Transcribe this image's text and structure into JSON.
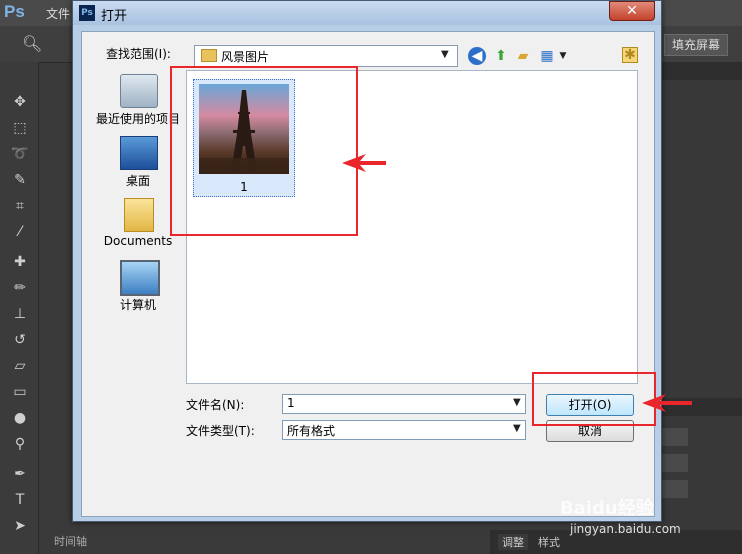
{
  "ps": {
    "logo": "Ps",
    "menu_file": "文件",
    "fill_screen": "填充屏幕",
    "timeline_tab": "时间轴",
    "adjust_tab": "调整",
    "style_tab": "样式"
  },
  "dialog": {
    "title": "打开",
    "close_symbol": "✕",
    "lookin_label": "查找范围(I):",
    "lookin_value": "风景图片",
    "places": [
      "最近使用的项目",
      "桌面",
      "Documents",
      "计算机"
    ],
    "file_item_label": "1",
    "filename_label": "文件名(N):",
    "filename_value": "1",
    "filetype_label": "文件类型(T):",
    "filetype_value": "所有格式",
    "open_button": "打开(O)",
    "cancel_button": "取消"
  },
  "watermark": {
    "brand": "Baidu经验",
    "url": "jingyan.baidu.com"
  },
  "colors": {
    "annotation_red": "#e8262b",
    "ps_dark": "#3a3a3a",
    "dialog_frame": "#b8cde6"
  }
}
